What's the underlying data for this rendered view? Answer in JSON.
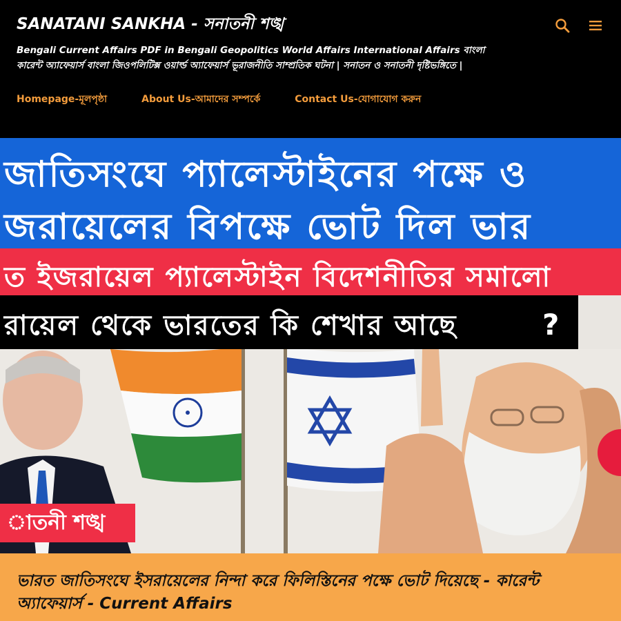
{
  "header": {
    "site_title": "SANATANI SANKHA - সনাতনী শঙ্খ",
    "description": "Bengali Current Affairs PDF in Bengali Geopolitics World Affairs International Affairs বাংলা কারেন্ট অ্যাফেয়ার্স বাংলা জিওপলিটিক্স ওয়ার্ল্ড অ্যাফেয়ার্স ভূরাজনীতি সাম্প্রতিক ঘটনা | সনাতন ও সনাতনী দৃষ্টিভঙ্গিতে |",
    "search_icon": "search-icon",
    "menu_icon": "hamburger-menu-icon"
  },
  "nav": {
    "items": [
      {
        "label": "Homepage-মূলপৃষ্ঠা"
      },
      {
        "label": "About Us-আমাদের সম্পর্কে"
      },
      {
        "label": "Contact Us-যোগাযোগ করুন"
      }
    ]
  },
  "hero": {
    "line1": "জাতিসংঘে প্যালেস্টাইনের পক্ষে ও",
    "line2": "জরায়েলের বিপক্ষে ভোট দিল ভার",
    "line3": "ত ইজরায়েল প্যালেস্টাইন বিদেশনীতির সমালো",
    "line4": "রায়েল থেকে ভারতের কি শেখার আছে",
    "question_mark": "?",
    "brand_tag": "াতনী শঙ্খ"
  },
  "post": {
    "title": "ভারত জাতিসংঘে ইসরায়েলের নিন্দা করে ফিলিস্তিনের পক্ষে ভোট দিয়েছে - কারেন্ট অ্যাফেয়ার্স - Current Affairs"
  },
  "colors": {
    "header_bg": "#000000",
    "accent_orange": "#f39c3c",
    "title_bar_bg": "#f7a74a",
    "hero_blue": "#1565d8",
    "hero_red": "#ef2f46"
  }
}
